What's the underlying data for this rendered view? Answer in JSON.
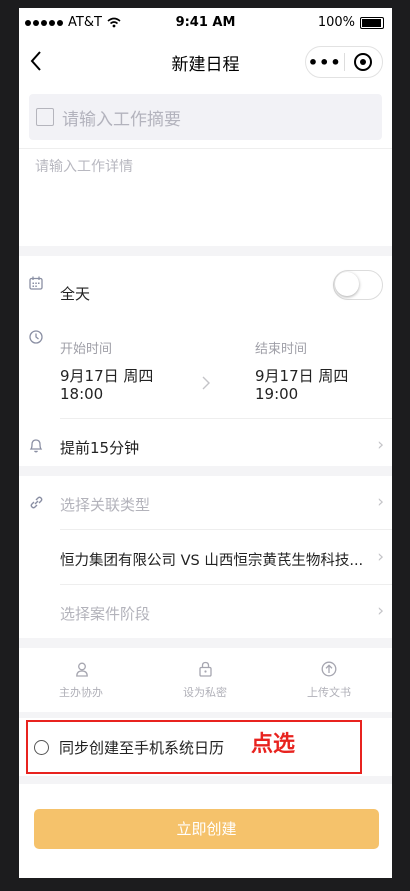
{
  "status_bar": {
    "carrier": "AT&T",
    "time": "9:41 AM",
    "battery": "100%"
  },
  "nav": {
    "title": "新建日程",
    "more_label": "•••"
  },
  "summary": {
    "placeholder": "请输入工作摘要"
  },
  "detail": {
    "placeholder": "请输入工作详情"
  },
  "schedule": {
    "all_day_label": "全天",
    "all_day_enabled": false,
    "start_label": "开始时间",
    "start_date": "9月17日 周四",
    "start_time": "18:00",
    "end_label": "结束时间",
    "end_date": "9月17日 周四",
    "end_time": "19:00",
    "reminder": "提前15分钟"
  },
  "relation": {
    "type_placeholder": "选择关联类型",
    "case_name": "恒力集团有限公司 VS 山西恒宗黄芪生物科技...",
    "stage_placeholder": "选择案件阶段"
  },
  "actions": [
    {
      "label": "主办协办",
      "icon": "person-icon"
    },
    {
      "label": "设为私密",
      "icon": "lock-icon"
    },
    {
      "label": "上传文书",
      "icon": "upload-icon"
    }
  ],
  "sync": {
    "label": "同步创建至手机系统日历",
    "selected": false
  },
  "annotation": {
    "text": "点选",
    "color": "#e8231f"
  },
  "submit": {
    "label": "立即创建",
    "color": "#f5c26b"
  }
}
